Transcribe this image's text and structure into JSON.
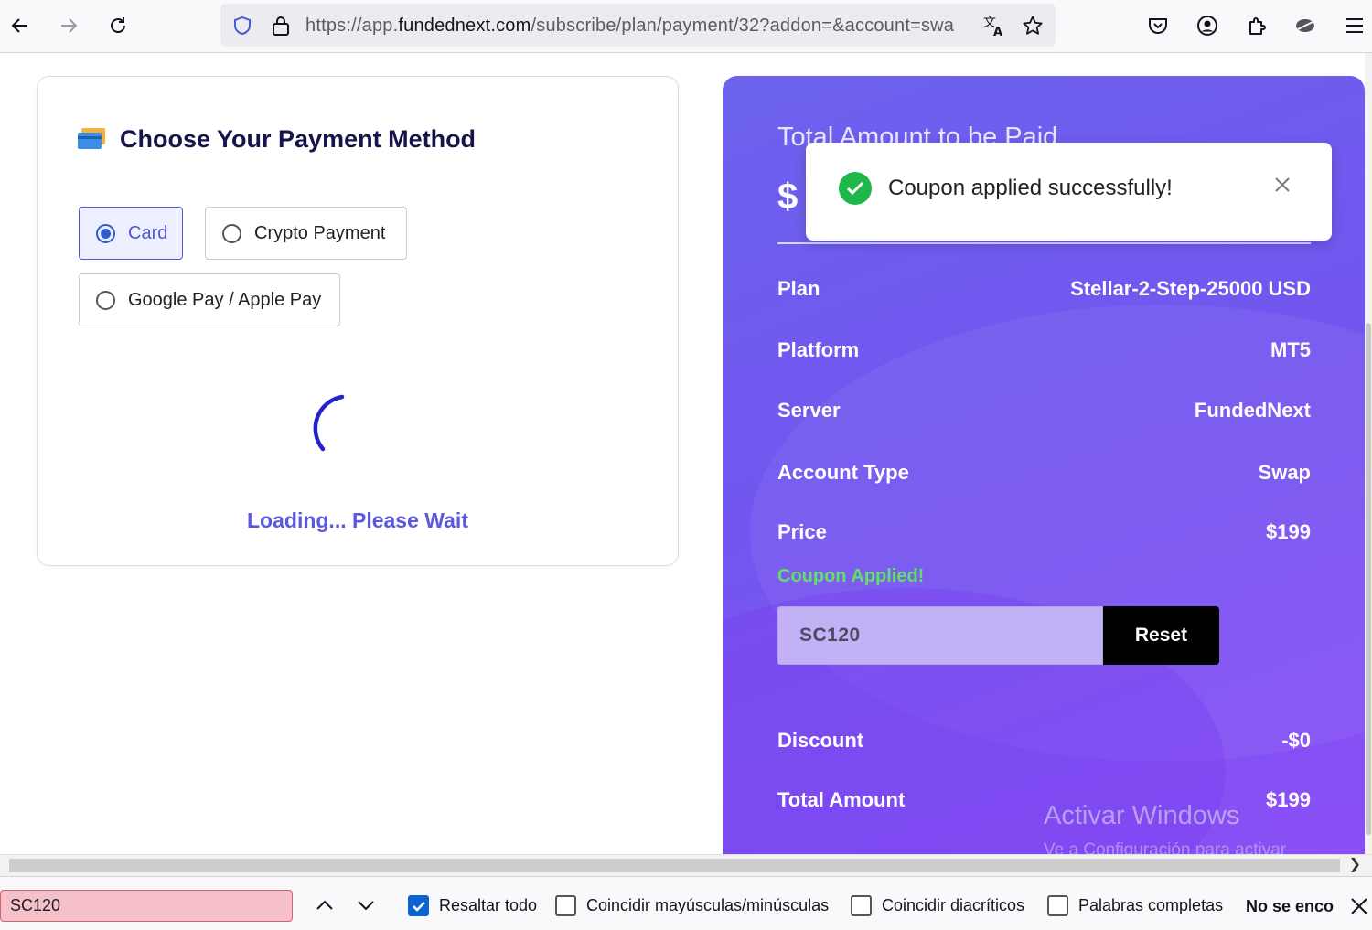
{
  "browser": {
    "url_prefix": "https://app.",
    "url_host": "fundednext.com",
    "url_rest": "/subscribe/plan/payment/32?addon=&account=swa"
  },
  "payment": {
    "title": "Choose Your Payment Method",
    "options": [
      {
        "label": "Card",
        "selected": true
      },
      {
        "label": "Crypto Payment",
        "selected": false
      },
      {
        "label": "Google Pay / Apple Pay",
        "selected": false
      }
    ],
    "loading_text": "Loading... Please Wait"
  },
  "summary": {
    "title": "Total Amount to be Paid",
    "amount_visible": "$",
    "rows": [
      {
        "label": "Plan",
        "value": "Stellar-2-Step-25000 USD"
      },
      {
        "label": "Platform",
        "value": "MT5"
      },
      {
        "label": "Server",
        "value": "FundedNext"
      },
      {
        "label": "Account Type",
        "value": "Swap"
      },
      {
        "label": "Price",
        "value": "$199"
      }
    ],
    "coupon_note": "Coupon Applied!",
    "coupon_code": "SC120",
    "reset_label": "Reset",
    "discount_label": "Discount",
    "discount_value": "-$0",
    "total_label": "Total Amount",
    "total_value": "$199",
    "accent_color": "#7256ef"
  },
  "toast": {
    "message": "Coupon applied successfully!"
  },
  "watermark": {
    "title": "Activar Windows",
    "subtitle": "Ve a Configuración para activar Windows."
  },
  "findbar": {
    "query": "SC120",
    "highlight_all": "Resaltar todo",
    "match_case": "Coincidir mayúsculas/minúsculas",
    "match_diacritics": "Coincidir diacríticos",
    "whole_words": "Palabras completas",
    "status": "No se encontraron coincidencias"
  }
}
